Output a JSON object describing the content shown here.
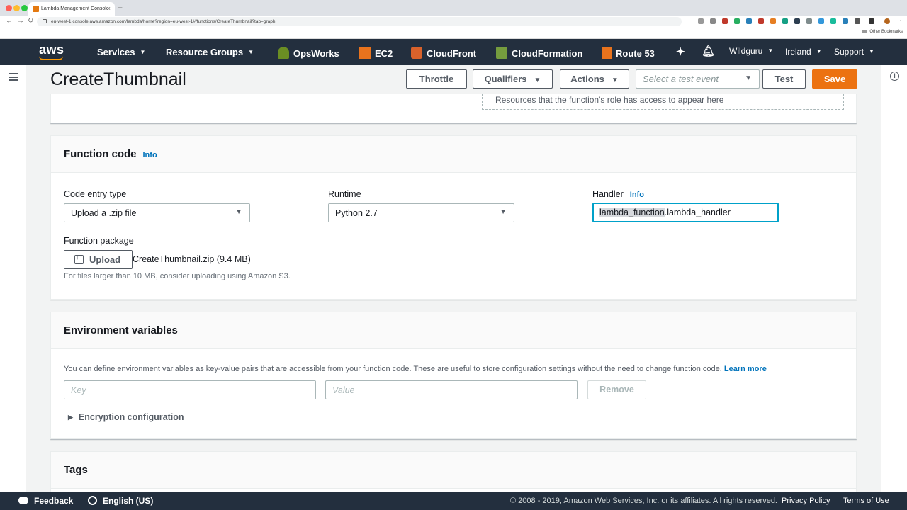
{
  "browser": {
    "tab_title": "Lambda Management Console",
    "url": "eu-west-1.console.aws.amazon.com/lambda/home?region=eu-west-1#/functions/CreateThumbnail?tab=graph",
    "other_bookmarks": "Other Bookmarks"
  },
  "aws_nav": {
    "logo": "aws",
    "services": "Services",
    "resource_groups": "Resource Groups",
    "shortcuts": [
      "OpsWorks",
      "EC2",
      "CloudFront",
      "CloudFormation",
      "Route 53"
    ],
    "account": "Wildguru",
    "region": "Ireland",
    "support": "Support"
  },
  "header": {
    "title": "CreateThumbnail",
    "throttle": "Throttle",
    "qualifiers": "Qualifiers",
    "actions": "Actions",
    "test_event_placeholder": "Select a test event",
    "test": "Test",
    "save": "Save"
  },
  "resources_note": "Resources that the function's role has access to appear here",
  "function_code": {
    "title": "Function code",
    "info": "Info",
    "code_entry_label": "Code entry type",
    "code_entry_value": "Upload a .zip file",
    "runtime_label": "Runtime",
    "runtime_value": "Python 2.7",
    "handler_label": "Handler",
    "handler_info": "Info",
    "handler_selected": "lambda_function",
    "handler_rest": ".lambda_handler",
    "package_label": "Function package",
    "upload": "Upload",
    "file_name": "CreateThumbnail.zip (9.4 MB)",
    "hint": "For files larger than 10 MB, consider uploading using Amazon S3."
  },
  "env_vars": {
    "title": "Environment variables",
    "description": "You can define environment variables as key-value pairs that are accessible from your function code. These are useful to store configuration settings without the need to change function code.",
    "learn_more": "Learn more",
    "key_placeholder": "Key",
    "value_placeholder": "Value",
    "remove": "Remove",
    "encryption": "Encryption configuration"
  },
  "tags": {
    "title": "Tags"
  },
  "footer": {
    "feedback": "Feedback",
    "language": "English (US)",
    "copyright": "© 2008 - 2019, Amazon Web Services, Inc. or its affiliates. All rights reserved.",
    "privacy": "Privacy Policy",
    "terms": "Terms of Use"
  },
  "colors": {
    "nav_bg": "#232f3e",
    "accent_orange": "#ec7211",
    "link_blue": "#0073bb",
    "focus_cyan": "#00a1c9"
  }
}
